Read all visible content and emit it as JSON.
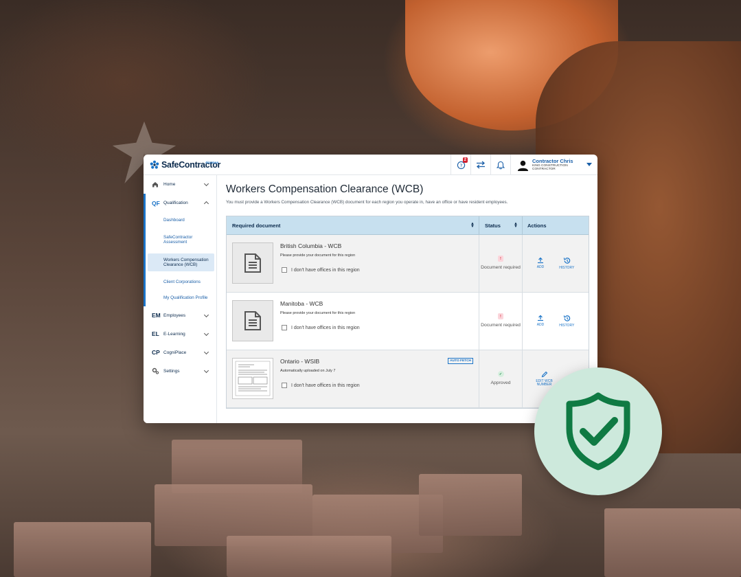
{
  "brand": {
    "name": "SafeContractor",
    "sub_brand": "Alcumus"
  },
  "header": {
    "notification_badge": "2",
    "user": {
      "name": "Contractor Chris",
      "company": "KING CONSTRUCTION",
      "role": "CONTRACTOR"
    }
  },
  "sidebar": {
    "home": {
      "label": "Home"
    },
    "qualification": {
      "prefix": "QF",
      "label": "Qualification",
      "items": [
        {
          "label": "Dashboard"
        },
        {
          "label": "SafeContractor Assessment"
        },
        {
          "label": "Workers Compensation Clearance (WCB)"
        },
        {
          "label": "Client Corporations"
        },
        {
          "label": "My Qualification Profile"
        }
      ]
    },
    "employees": {
      "prefix": "EM",
      "label": "Employees"
    },
    "elearning": {
      "prefix": "EL",
      "label": "E-Learning"
    },
    "cogniplace": {
      "prefix": "CP",
      "label": "CogniPlace"
    },
    "settings": {
      "label": "Settings"
    }
  },
  "main": {
    "title": "Workers Compensation Clearance (WCB)",
    "description": "You must provide a Workers Compensation Clearance (WCB) document for each region you operate in, have an office or have resident employees.",
    "table": {
      "headers": {
        "document": "Required document",
        "status": "Status",
        "actions": "Actions"
      },
      "rows": [
        {
          "title": "British Columbia - WCB",
          "subtitle": "Please provide your document for this region",
          "checkbox_label": "I don't have offices in this region",
          "status": "Document required",
          "action_1": "ADD",
          "action_2": "HISTORY"
        },
        {
          "title": "Manitoba - WCB",
          "subtitle": "Please provide your document for this region",
          "checkbox_label": "I don't have offices in this region",
          "status": "Document required",
          "action_1": "ADD",
          "action_2": "HISTORY"
        },
        {
          "title": "Ontario - WSIB",
          "badge": "AUTO FETCH",
          "subtitle": "Automatically uploaded on July 7",
          "checkbox_label": "I don't have offices in this region",
          "status": "Approved",
          "action_1": "EDIT WCB NUMBER"
        }
      ]
    }
  },
  "colors": {
    "brand_navy": "#0c2b4d",
    "brand_blue": "#1a73c7",
    "table_header": "#c7e0ef",
    "alert_red": "#d3202f",
    "success_green": "#1e8a48",
    "shield_bg": "#cde9dc"
  }
}
